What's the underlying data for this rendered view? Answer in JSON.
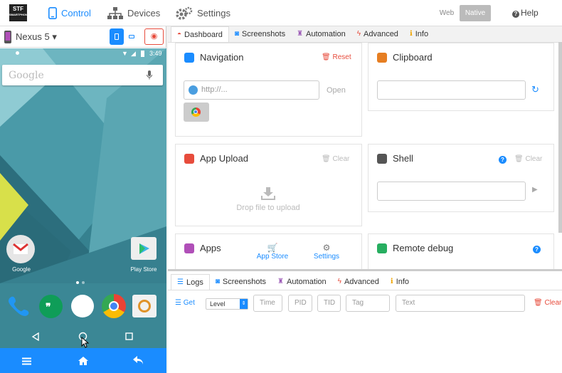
{
  "app": {
    "logo_text": "STF",
    "logo_sub": "SMARTPHONE"
  },
  "topnav": {
    "control": "Control",
    "devices": "Devices",
    "settings": "Settings",
    "web": "Web",
    "native": "Native",
    "help": "Help"
  },
  "device": {
    "name": "Nexus 5",
    "status_time": "3:49",
    "search_placeholder": "Google",
    "apps": [
      {
        "label": "Google"
      },
      {
        "label": "Play Store"
      }
    ]
  },
  "dashboard": {
    "tabs": [
      "Dashboard",
      "Screenshots",
      "Automation",
      "Advanced",
      "Info"
    ],
    "navigation": {
      "title": "Navigation",
      "reset": "Reset",
      "url_placeholder": "http://...",
      "open": "Open"
    },
    "clipboard": {
      "title": "Clipboard"
    },
    "upload": {
      "title": "App Upload",
      "clear": "Clear",
      "drop": "Drop file to upload"
    },
    "shell": {
      "title": "Shell",
      "clear": "Clear"
    },
    "apps": {
      "title": "Apps",
      "app_store": "App Store",
      "settings": "Settings"
    },
    "remote_debug": {
      "title": "Remote debug"
    }
  },
  "bottom": {
    "tabs": [
      "Logs",
      "Screenshots",
      "Automation",
      "Advanced",
      "Info"
    ],
    "get": "Get",
    "level": "Level",
    "time": "Time",
    "pid": "PID",
    "tid": "TID",
    "tag": "Tag",
    "text": "Text",
    "clear": "Clear"
  },
  "colors": {
    "accent": "#1a8cff",
    "danger": "#e74c3c"
  }
}
